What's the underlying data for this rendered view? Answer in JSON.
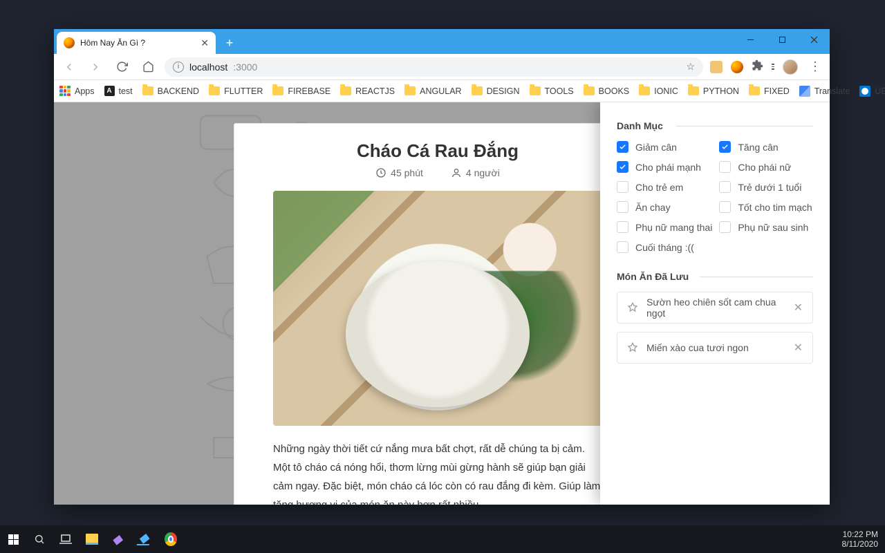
{
  "window": {
    "tab_title": "Hôm Nay Ăn Gì ?",
    "tab_close": "✕",
    "new_tab": "+"
  },
  "address": {
    "host": "localhost",
    "port": ":3000",
    "star": "☆"
  },
  "bookmarks": {
    "apps": "Apps",
    "items": [
      "test",
      "BACKEND",
      "FLUTTER",
      "FIREBASE",
      "REACTJS",
      "ANGULAR",
      "DESIGN",
      "TOOLS",
      "BOOKS",
      "IONIC",
      "PYTHON",
      "FIXED"
    ],
    "translate": "Translate",
    "uetmail": "UETMail - Đăng nhập",
    "overflow": "»"
  },
  "recipe": {
    "title": "Cháo Cá Rau Đắng",
    "time": "45 phút",
    "servings": "4 người",
    "description": "Những ngày thời tiết cứ nắng mưa bất chợt, rất dễ chúng ta bị cảm. Một tô cháo cá nóng hổi, thơm lừng mùi gừng hành sẽ giúp bạn giải cảm ngay. Đặc biệt, món cháo cá lóc còn có rau đắng đi kèm. Giúp làm tăng hương vị của món ăn này hơn rất nhiều."
  },
  "panel": {
    "categories_title": "Danh Mục",
    "saved_title": "Món Ăn Đã Lưu",
    "categories": [
      {
        "label": "Giảm cân",
        "checked": true
      },
      {
        "label": "Tăng cân",
        "checked": true
      },
      {
        "label": "Cho phái mạnh",
        "checked": true
      },
      {
        "label": "Cho phái nữ",
        "checked": false
      },
      {
        "label": "Cho trẻ em",
        "checked": false
      },
      {
        "label": "Trẻ dưới 1 tuổi",
        "checked": false
      },
      {
        "label": "Ăn chay",
        "checked": false
      },
      {
        "label": "Tốt cho tim mạch",
        "checked": false
      },
      {
        "label": "Phụ nữ mang thai",
        "checked": false
      },
      {
        "label": "Phụ nữ sau sinh",
        "checked": false
      },
      {
        "label": "Cuối tháng :((",
        "checked": false
      }
    ],
    "saved": [
      "Sườn heo chiên sốt cam chua ngọt",
      "Miến xào cua tươi ngon"
    ]
  },
  "taskbar": {
    "time": "10:22 PM",
    "date": "8/11/2020"
  }
}
